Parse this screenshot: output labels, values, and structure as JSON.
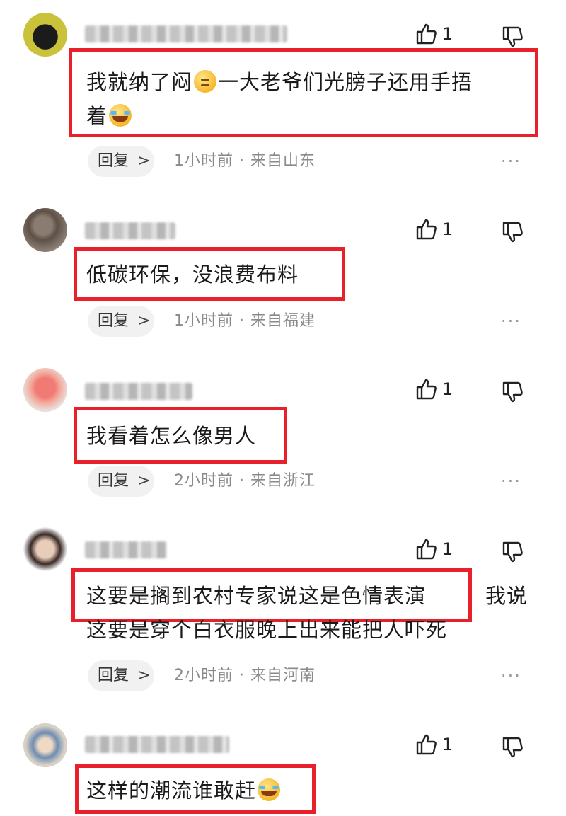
{
  "comments": [
    {
      "like_count": "1",
      "text_lines": [
        "我就纳了闷",
        "一大老爷们光膀子还用手捂",
        "着"
      ],
      "emoji_1": "sigh-face-emoji",
      "emoji_2": "crying-face-emoji",
      "reply_label": "回复",
      "reply_chevron": ">",
      "time": "1小时前",
      "separator": "·",
      "location": "来自山东",
      "more": "···"
    },
    {
      "like_count": "1",
      "text_lines": [
        "低碳环保，没浪费布料"
      ],
      "reply_label": "回复",
      "reply_chevron": ">",
      "time": "1小时前",
      "separator": "·",
      "location": "来自福建",
      "more": "···"
    },
    {
      "like_count": "1",
      "text_lines": [
        "我看着怎么像男人"
      ],
      "reply_label": "回复",
      "reply_chevron": ">",
      "time": "2小时前",
      "separator": "·",
      "location": "来自浙江",
      "more": "···"
    },
    {
      "like_count": "1",
      "text_lines": [
        "这要是搁到农村专家说这是色情表演",
        "我说",
        "这要是穿个白衣服晚上出来能把人吓死"
      ],
      "reply_label": "回复",
      "reply_chevron": ">",
      "time": "2小时前",
      "separator": "·",
      "location": "来自河南",
      "more": "···"
    },
    {
      "like_count": "1",
      "text_lines": [
        "这样的潮流谁敢赶"
      ],
      "emoji_1": "crying-face-emoji"
    }
  ],
  "icons": {
    "like": "thumbs-up-icon",
    "dislike": "thumbs-down-icon"
  },
  "colors": {
    "highlight_border": "#e8202a",
    "meta_text": "#8a8a8a",
    "reply_bg": "#f1f1f1"
  }
}
